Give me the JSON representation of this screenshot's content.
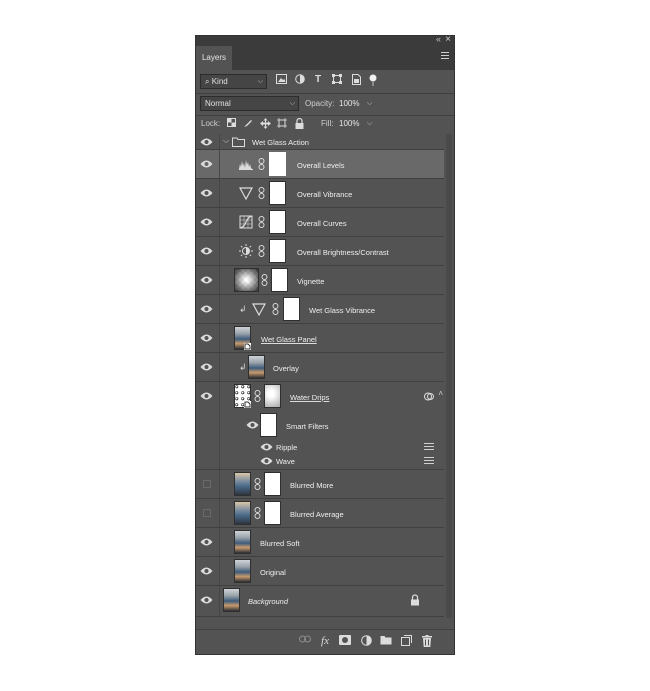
{
  "panel": {
    "tab_label": "Layers",
    "collapse_glyph": "‹‹",
    "close_glyph": "×"
  },
  "filter": {
    "kind_label": "Kind",
    "icons": [
      "image-filter-icon",
      "adjustment-filter-icon",
      "type-filter-icon",
      "shape-filter-icon",
      "smart-object-filter-icon",
      "filter-toggle-icon"
    ]
  },
  "blend": {
    "mode": "Normal",
    "opacity_label": "Opacity:",
    "opacity_value": "100%"
  },
  "lock": {
    "label": "Lock:",
    "fill_label": "Fill:",
    "fill_value": "100%"
  },
  "layers": [
    {
      "name": "Wet Glass Action",
      "type": "group",
      "visible": true
    },
    {
      "name": "Overall Levels",
      "type": "adjustment",
      "icon": "levels-icon",
      "visible": true,
      "selected": true
    },
    {
      "name": "Overall Vibrance",
      "type": "adjustment",
      "icon": "vibrance-icon",
      "visible": true
    },
    {
      "name": "Overall Curves",
      "type": "adjustment",
      "icon": "curves-icon",
      "visible": true
    },
    {
      "name": "Overall Brightness/Contrast",
      "type": "adjustment",
      "icon": "brightness-icon",
      "visible": true
    },
    {
      "name": "Vignette",
      "type": "pixel-mask",
      "visible": true
    },
    {
      "name": "Wet Glass Vibrance",
      "type": "adjustment-clipped",
      "icon": "vibrance-icon",
      "visible": true
    },
    {
      "name": "Wet Glass Panel",
      "type": "smart-object",
      "visible": true
    },
    {
      "name": "Overlay",
      "type": "pixel-clipped",
      "visible": true
    },
    {
      "name": "Water Drips",
      "type": "smart-object-mask",
      "visible": true
    },
    {
      "name": "Smart Filters",
      "type": "smart-filters",
      "visible": true
    },
    {
      "name": "Ripple",
      "type": "filter",
      "visible": true
    },
    {
      "name": "Wave",
      "type": "filter",
      "visible": true
    },
    {
      "name": "Blurred More",
      "type": "pixel-mask",
      "visible": false
    },
    {
      "name": "Blurred Average",
      "type": "pixel-mask",
      "visible": false
    },
    {
      "name": "Blurred Soft",
      "type": "pixel",
      "visible": true
    },
    {
      "name": "Original",
      "type": "pixel",
      "visible": true
    },
    {
      "name": "Background",
      "type": "background",
      "visible": true
    }
  ],
  "bottom_bar": {
    "fx_label": "fx",
    "icons": [
      "link-layers-icon",
      "fx-icon",
      "add-mask-icon",
      "new-adjustment-icon",
      "new-group-icon",
      "new-layer-icon",
      "delete-icon"
    ]
  }
}
